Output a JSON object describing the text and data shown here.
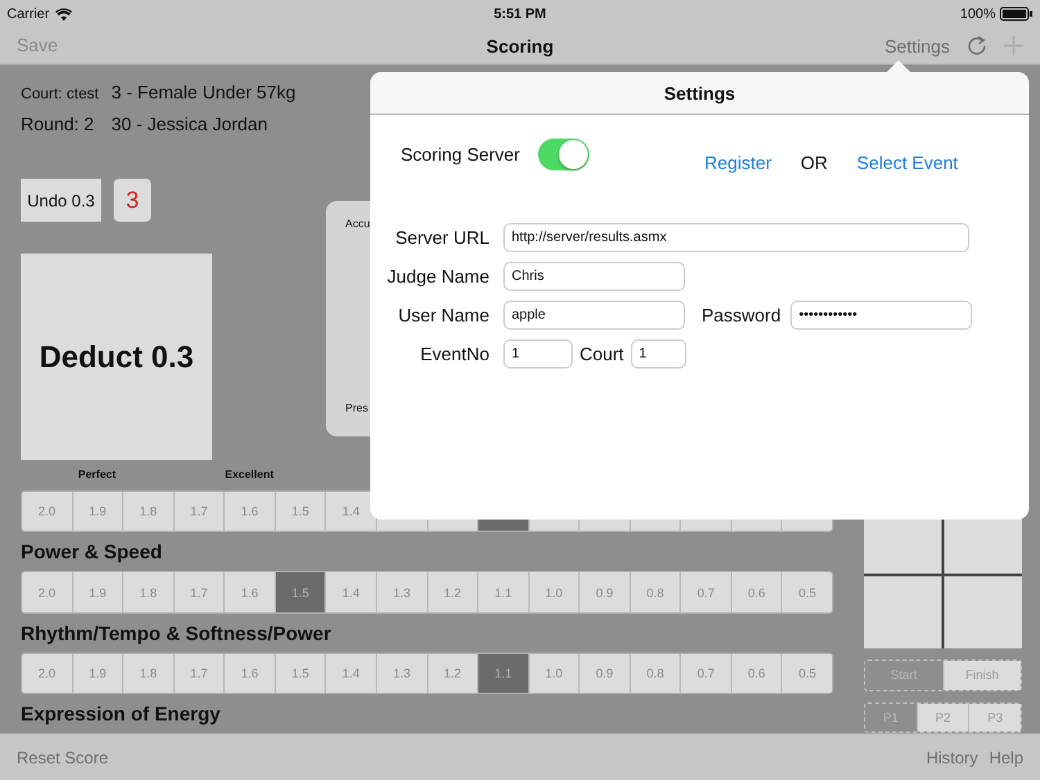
{
  "status_bar": {
    "carrier": "Carrier",
    "time": "5:51 PM",
    "battery": "100%"
  },
  "nav_bar": {
    "left_button": "Save",
    "title": "Scoring",
    "settings_button": "Settings"
  },
  "match": {
    "court_label": "Court: ctest",
    "division": "3 - Female Under 57kg",
    "round_label": "Round: 2",
    "competitor": "30 - Jessica Jordan"
  },
  "undo_button": "Undo 0.3",
  "deduction_count": "3",
  "deduct_button": "Deduct 0.3",
  "side_panel": {
    "top_label": "Accu",
    "bottom_label": "Pres"
  },
  "score_sections": [
    {
      "cells": [
        {
          "value": "2.0",
          "selected": false
        },
        {
          "value": "1.9",
          "grade": "Perfect",
          "selected": false
        },
        {
          "value": "1.8",
          "selected": false
        },
        {
          "value": "1.7",
          "selected": false
        },
        {
          "value": "1.6",
          "grade": "Excellent",
          "selected": false
        },
        {
          "value": "1.5",
          "selected": false
        },
        {
          "value": "1.4",
          "selected": false
        },
        {
          "selected": false
        },
        {
          "selected": false
        },
        {
          "selected": true
        },
        {
          "selected": false
        },
        {
          "selected": false
        },
        {
          "selected": false
        },
        {
          "selected": false
        },
        {
          "selected": false
        },
        {
          "selected": false
        }
      ]
    },
    {
      "title": "Power & Speed",
      "cells": [
        {
          "value": "2.0",
          "selected": false
        },
        {
          "value": "1.9",
          "selected": false
        },
        {
          "value": "1.8",
          "selected": false
        },
        {
          "value": "1.7",
          "selected": false
        },
        {
          "value": "1.6",
          "selected": false
        },
        {
          "value": "1.5",
          "selected": true
        },
        {
          "value": "1.4",
          "selected": false
        },
        {
          "value": "1.3",
          "selected": false
        },
        {
          "value": "1.2",
          "selected": false
        },
        {
          "value": "1.1",
          "selected": false
        },
        {
          "value": "1.0",
          "selected": false
        },
        {
          "value": "0.9",
          "selected": false
        },
        {
          "value": "0.8",
          "selected": false
        },
        {
          "value": "0.7",
          "selected": false
        },
        {
          "value": "0.6",
          "selected": false
        },
        {
          "value": "0.5",
          "selected": false
        }
      ]
    },
    {
      "title": "Rhythm/Tempo & Softness/Power",
      "cells": [
        {
          "value": "2.0",
          "selected": false
        },
        {
          "value": "1.9",
          "selected": false
        },
        {
          "value": "1.8",
          "selected": false
        },
        {
          "value": "1.7",
          "selected": false
        },
        {
          "value": "1.6",
          "selected": false
        },
        {
          "value": "1.5",
          "selected": false
        },
        {
          "value": "1.4",
          "selected": false
        },
        {
          "value": "1.3",
          "selected": false
        },
        {
          "value": "1.2",
          "selected": false
        },
        {
          "value": "1.1",
          "selected": true
        },
        {
          "value": "1.0",
          "selected": false
        },
        {
          "value": "0.9",
          "selected": false
        },
        {
          "value": "0.8",
          "selected": false
        },
        {
          "value": "0.7",
          "selected": false
        },
        {
          "value": "0.6",
          "selected": false
        },
        {
          "value": "0.5",
          "selected": false
        }
      ]
    },
    {
      "title": "Expression of Energy"
    }
  ],
  "timer_buttons": [
    {
      "label": "Start",
      "selected": true
    },
    {
      "label": "Finish",
      "selected": false
    }
  ],
  "period_buttons": [
    {
      "label": "P1",
      "selected": true
    },
    {
      "label": "P2",
      "selected": false
    },
    {
      "label": "P3",
      "selected": false
    }
  ],
  "settings": {
    "title": "Settings",
    "scoring_server": {
      "label": "Scoring Server",
      "on": true
    },
    "register_link": "Register",
    "or_text": "OR",
    "select_event_link": "Select Event",
    "server_url": {
      "label": "Server URL",
      "value": "http://server/results.asmx"
    },
    "judge_name": {
      "label": "Judge Name",
      "value": "Chris"
    },
    "user_name": {
      "label": "User Name",
      "value": "apple"
    },
    "password": {
      "label": "Password",
      "value": "••••••••••••"
    },
    "event_no": {
      "label": "EventNo",
      "value": "1"
    },
    "court": {
      "label": "Court",
      "value": "1"
    }
  },
  "toolbar": {
    "reset_button": "Reset Score",
    "history_button": "History",
    "help_button": "Help"
  }
}
